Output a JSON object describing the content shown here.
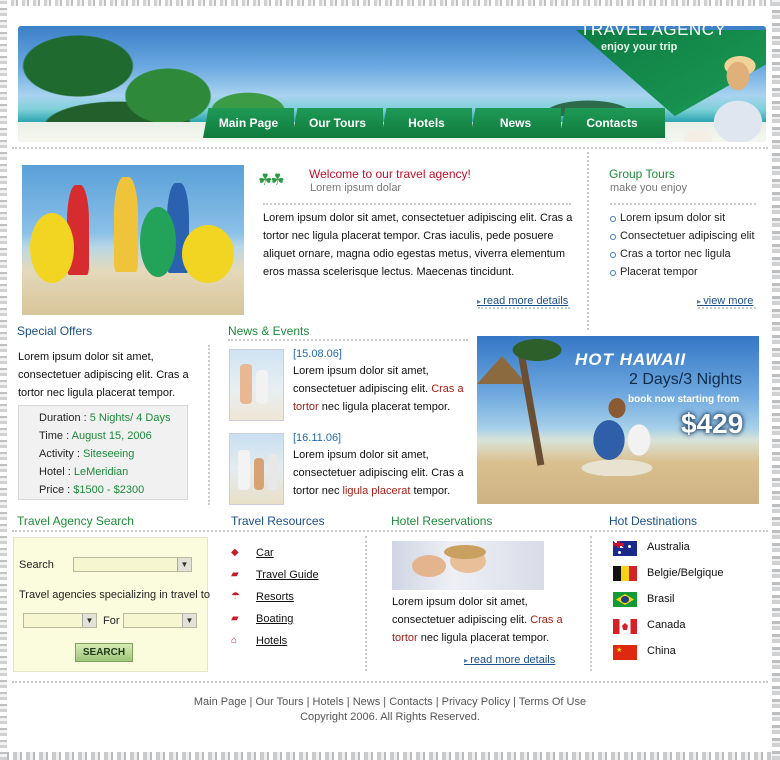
{
  "brand": {
    "title": "TRAVEL AGENCY",
    "tagline": "enjoy your trip"
  },
  "nav": [
    "Main Page",
    "Our Tours",
    "Hotels",
    "News",
    "Contacts"
  ],
  "welcome": {
    "title": "Welcome to our travel agency!",
    "subtitle": "Lorem ipsum dolar",
    "body": "Lorem ipsum dolor sit amet, consectetuer adipiscing elit. Cras a tortor nec ligula placerat tempor. Cras iaculis, pede posuere aliquet ornare, magna odio egestas metus, viverra elementum eros massa scelerisque lectus. Maecenas tincidunt.",
    "link": "read more details"
  },
  "group_tours": {
    "title": "Group Tours",
    "subtitle": "make you enjoy",
    "items": [
      "Lorem ipsum dolor sit",
      "Consectetuer adipiscing elit",
      "Cras a tortor nec ligula",
      "Placerat tempor"
    ],
    "link": "view more"
  },
  "special_offers": {
    "title": "Special Offers",
    "body": "Lorem ipsum dolor sit amet, consectetuer adipiscing elit. Cras a tortor nec ligula placerat tempor.",
    "details": [
      {
        "label": "Duration : ",
        "value": "5 Nights/ 4 Days"
      },
      {
        "label": "Time : ",
        "value": "August 15, 2006"
      },
      {
        "label": "Activity : ",
        "value": "Siteseeing"
      },
      {
        "label": "Hotel : ",
        "value": "LeMeridian"
      },
      {
        "label": "Price : ",
        "value": "$1500 - $2300"
      }
    ]
  },
  "news": {
    "title": "News & Events",
    "items": [
      {
        "date": "[15.08.06]",
        "pre": "Lorem ipsum dolor sit amet, consectetuer adipiscing elit. ",
        "highlight": "Cras a tortor",
        "post": " nec ligula placerat tempor."
      },
      {
        "date": "[16.11.06]",
        "pre": "Lorem ipsum dolor sit amet, consectetuer adipiscing elit. Cras a tortor nec ",
        "highlight": "ligula placerat",
        "post": " tempor."
      }
    ]
  },
  "hawaii": {
    "title": "HOT HAWAII",
    "nights": "2 Days/3 Nights",
    "book": "book now starting from",
    "price": "$429"
  },
  "search": {
    "title": "Travel Agency Search",
    "search_label": "Search",
    "specializing_label": "Travel agencies specializing in travel to",
    "for_label": "For",
    "button": "SEARCH"
  },
  "resources": {
    "title": "Travel Resources",
    "items": [
      {
        "icon": "car-icon",
        "label": "Car"
      },
      {
        "icon": "travel-guide-icon",
        "label": "Travel Guide"
      },
      {
        "icon": "resorts-icon",
        "label": "Resorts"
      },
      {
        "icon": "boating-icon",
        "label": "Boating"
      },
      {
        "icon": "hotels-icon",
        "label": "Hotels"
      }
    ]
  },
  "reservations": {
    "title": "Hotel Reservations",
    "pre": "Lorem ipsum dolor sit amet, consectetuer adipiscing elit. ",
    "highlight": "Cras a tortor",
    "post": " nec ligula placerat tempor.",
    "link": "read more details"
  },
  "destinations": {
    "title": "Hot Destinations",
    "items": [
      {
        "flag": "australia-flag-icon",
        "name": "Australia"
      },
      {
        "flag": "belgium-flag-icon",
        "name": "Belgie/Belgique"
      },
      {
        "flag": "brazil-flag-icon",
        "name": "Brasil"
      },
      {
        "flag": "canada-flag-icon",
        "name": "Canada"
      },
      {
        "flag": "china-flag-icon",
        "name": "China"
      }
    ]
  },
  "footer": {
    "links": [
      "Main Page",
      "Our Tours",
      "Hotels",
      "News",
      "Contacts",
      "Privacy Policy",
      "Terms Of Use"
    ],
    "separator": " | ",
    "copyright": "Copyright 2006. All Rights Reserved."
  },
  "colors": {
    "brand_green": "#1e8a3b",
    "title_blue": "#1b4f8a",
    "accent_red": "#c0102a",
    "link_red": "#a52018"
  }
}
